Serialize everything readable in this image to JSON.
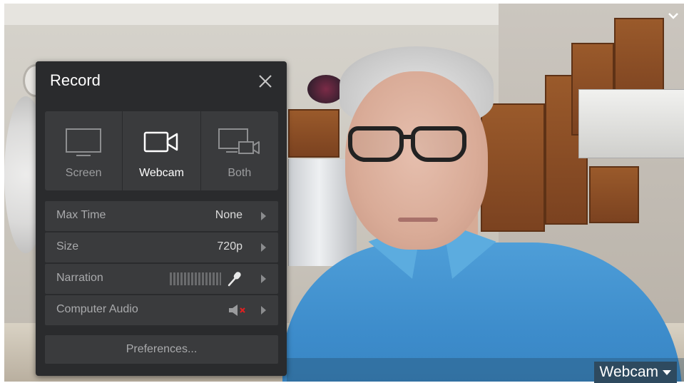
{
  "webcam_overlay": {
    "source_label": "Webcam"
  },
  "panel": {
    "title": "Record",
    "modes": [
      {
        "label": "Screen",
        "icon": "monitor-icon",
        "active": false
      },
      {
        "label": "Webcam",
        "icon": "camera-icon",
        "active": true
      },
      {
        "label": "Both",
        "icon": "monitor-camera-icon",
        "active": false
      }
    ],
    "settings": [
      {
        "label": "Max Time",
        "value": "None"
      },
      {
        "label": "Size",
        "value": "720p"
      },
      {
        "label": "Narration",
        "value": "",
        "icon": "microphone-icon"
      },
      {
        "label": "Computer Audio",
        "value": "",
        "icon": "speaker-muted-icon"
      }
    ],
    "preferences_label": "Preferences..."
  },
  "colors": {
    "panel_bg": "#2a2b2d",
    "row_bg": "#3a3b3d",
    "mute_red": "#e02020",
    "label_bar": "#2e4a5f"
  }
}
